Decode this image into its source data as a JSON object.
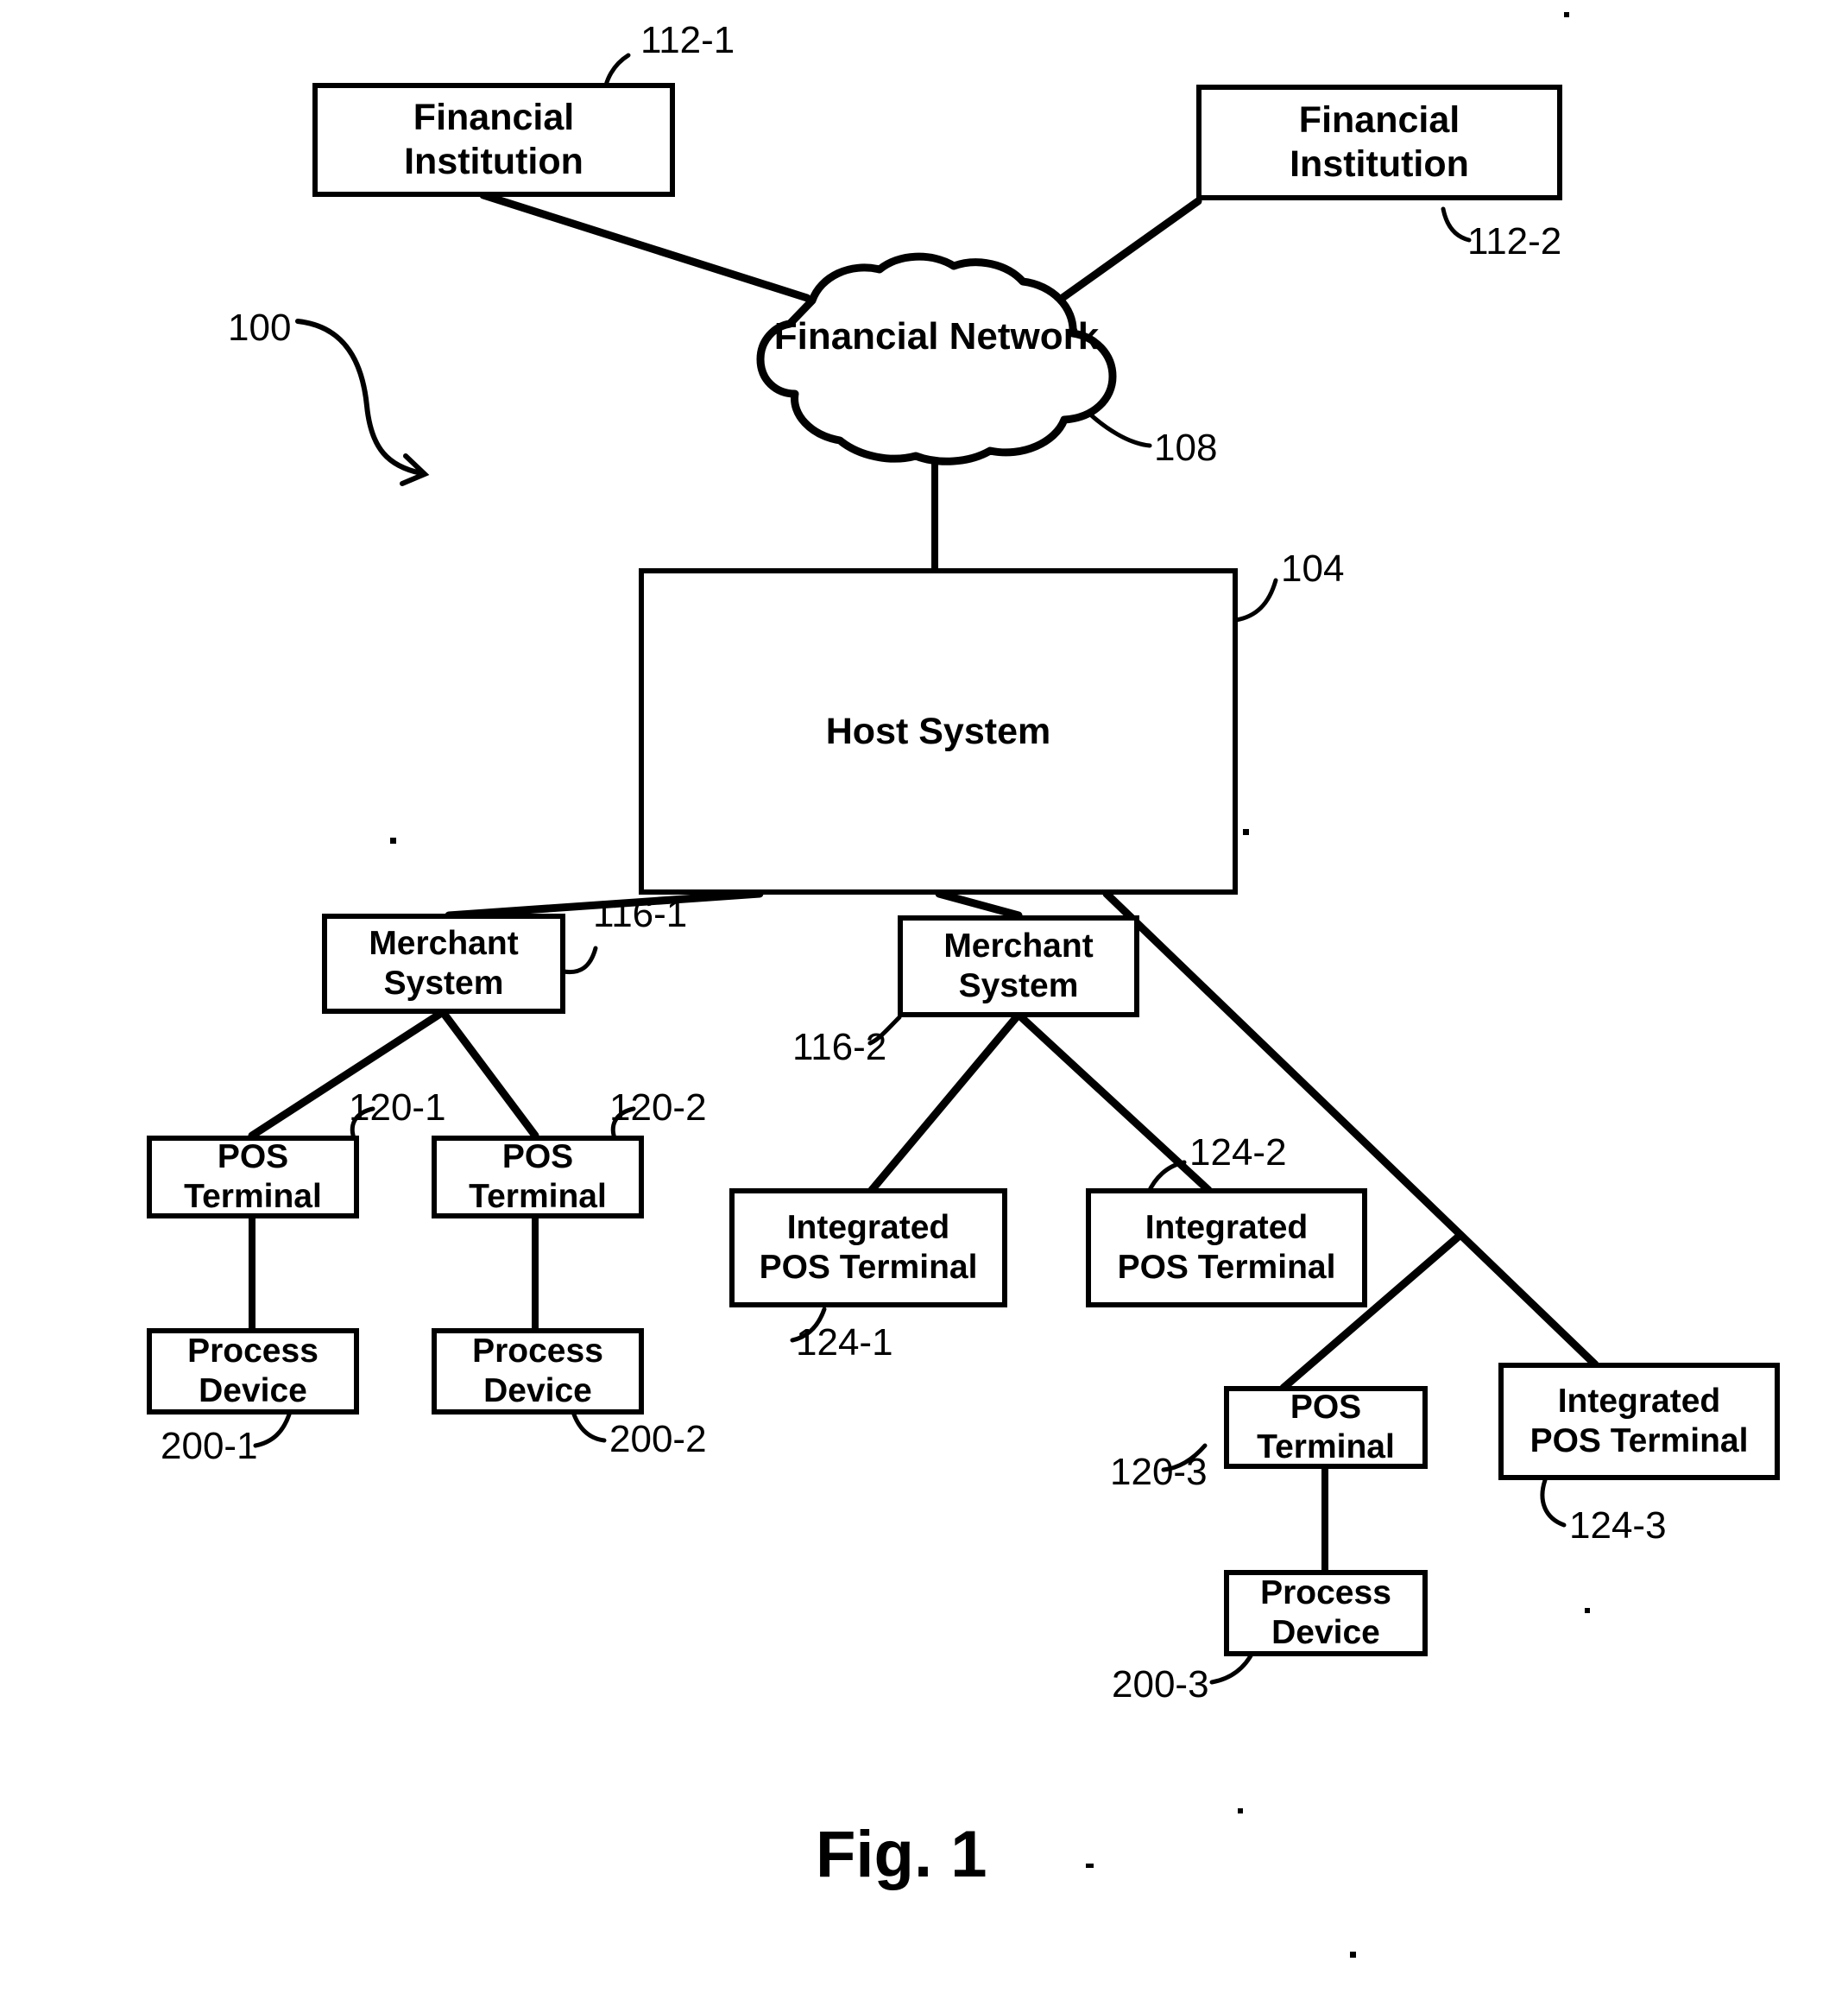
{
  "figure": {
    "caption": "Fig. 1",
    "system_ref": "100"
  },
  "nodes": {
    "financial_institution_1": {
      "label": "Financial\nInstitution",
      "ref": "112-1"
    },
    "financial_institution_2": {
      "label": "Financial\nInstitution",
      "ref": "112-2"
    },
    "financial_network": {
      "label": "Financial Network",
      "ref": "108"
    },
    "host_system": {
      "label": "Host System",
      "ref": "104"
    },
    "merchant_system_1": {
      "label": "Merchant\nSystem",
      "ref": "116-1"
    },
    "merchant_system_2": {
      "label": "Merchant\nSystem",
      "ref": "116-2"
    },
    "pos_terminal_1": {
      "label": "POS\nTerminal",
      "ref": "120-1"
    },
    "pos_terminal_2": {
      "label": "POS\nTerminal",
      "ref": "120-2"
    },
    "pos_terminal_3": {
      "label": "POS\nTerminal",
      "ref": "120-3"
    },
    "process_device_1": {
      "label": "Process\nDevice",
      "ref": "200-1"
    },
    "process_device_2": {
      "label": "Process\nDevice",
      "ref": "200-2"
    },
    "process_device_3": {
      "label": "Process\nDevice",
      "ref": "200-3"
    },
    "integrated_pos_terminal_1": {
      "label": "Integrated\nPOS Terminal",
      "ref": "124-1"
    },
    "integrated_pos_terminal_2": {
      "label": "Integrated\nPOS Terminal",
      "ref": "124-2"
    },
    "integrated_pos_terminal_3": {
      "label": "Integrated\nPOS Terminal",
      "ref": "124-3"
    }
  },
  "colors": {
    "ink": "#000000",
    "paper": "#ffffff"
  }
}
